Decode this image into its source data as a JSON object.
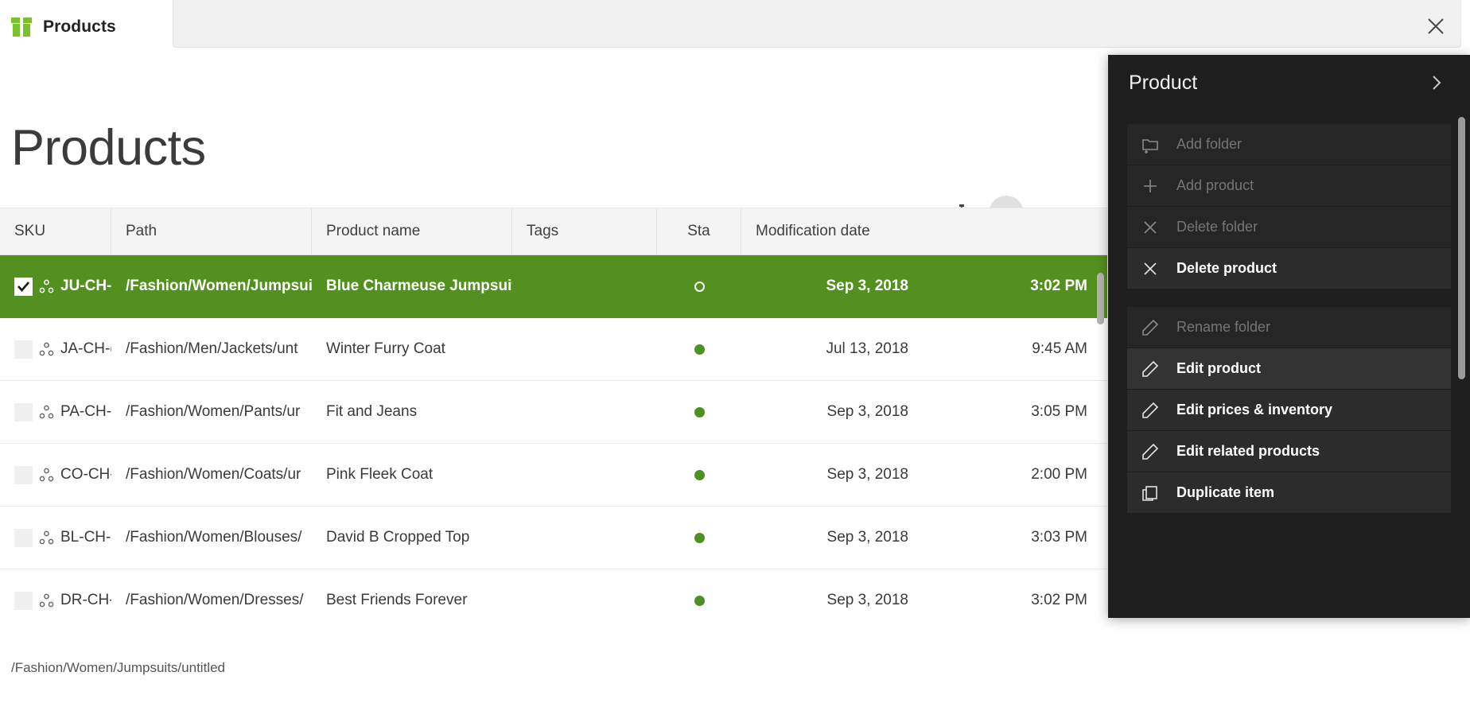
{
  "app": {
    "brand_label": "Products",
    "close_label": "×"
  },
  "page": {
    "title": "Products",
    "status_path": "/Fashion/Women/Jumpsuits/untitled"
  },
  "toolbar": {
    "tree_icon": "tree-view-icon",
    "menu_icon": "hamburger-menu-icon"
  },
  "table": {
    "columns": [
      {
        "key": "sku",
        "label": "SKU"
      },
      {
        "key": "path",
        "label": "Path"
      },
      {
        "key": "name",
        "label": "Product name"
      },
      {
        "key": "tags",
        "label": "Tags"
      },
      {
        "key": "status",
        "label": "Sta"
      },
      {
        "key": "date",
        "label": "Modification date"
      },
      {
        "key": "time",
        "label": ""
      }
    ],
    "rows": [
      {
        "sku": "JU-CH-(",
        "path": "/Fashion/Women/Jumpsui",
        "name": "Blue Charmeuse Jumpsuit",
        "tags": "",
        "status": "hollow",
        "date": "Sep 3, 2018",
        "time": "3:02 PM",
        "selected": true,
        "checked": true
      },
      {
        "sku": "JA-CH-(",
        "path": "/Fashion/Men/Jackets/unt",
        "name": "Winter Furry Coat",
        "tags": "",
        "status": "filled",
        "date": "Jul 13, 2018",
        "time": "9:45 AM",
        "selected": false,
        "checked": false
      },
      {
        "sku": "PA-CH-(",
        "path": "/Fashion/Women/Pants/ur",
        "name": "Fit and Jeans",
        "tags": "",
        "status": "filled",
        "date": "Sep 3, 2018",
        "time": "3:05 PM",
        "selected": false,
        "checked": false
      },
      {
        "sku": "CO-CH-(",
        "path": "/Fashion/Women/Coats/ur",
        "name": "Pink Fleek Coat",
        "tags": "",
        "status": "filled",
        "date": "Sep 3, 2018",
        "time": "2:00 PM",
        "selected": false,
        "checked": false
      },
      {
        "sku": "BL-CH-(",
        "path": "/Fashion/Women/Blouses/",
        "name": "David B Cropped Top",
        "tags": "",
        "status": "filled",
        "date": "Sep 3, 2018",
        "time": "3:03 PM",
        "selected": false,
        "checked": false
      },
      {
        "sku": "DR-CH-(",
        "path": "/Fashion/Women/Dresses/",
        "name": "Best Friends Forever",
        "tags": "",
        "status": "filled",
        "date": "Sep 3, 2018",
        "time": "3:02 PM",
        "selected": false,
        "checked": false
      }
    ]
  },
  "context_panel": {
    "title": "Product",
    "groups": [
      {
        "items": [
          {
            "label": "Add folder",
            "icon": "add-folder-icon",
            "state": "disabled"
          },
          {
            "label": "Add product",
            "icon": "plus-icon",
            "state": "disabled"
          },
          {
            "label": "Delete folder",
            "icon": "close-x-icon",
            "state": "disabled"
          },
          {
            "label": "Delete product",
            "icon": "close-x-icon",
            "state": "enabled"
          }
        ]
      },
      {
        "items": [
          {
            "label": "Rename folder",
            "icon": "pencil-icon",
            "state": "disabled"
          },
          {
            "label": "Edit product",
            "icon": "pencil-icon",
            "state": "hover"
          },
          {
            "label": "Edit prices & inventory",
            "icon": "pencil-icon",
            "state": "enabled"
          },
          {
            "label": "Edit related products",
            "icon": "pencil-icon",
            "state": "enabled"
          },
          {
            "label": "Duplicate item",
            "icon": "duplicate-icon",
            "state": "enabled"
          }
        ]
      }
    ]
  },
  "colors": {
    "brand_green": "#7cc02e",
    "selection_green": "#54901f",
    "status_green": "#4f9022",
    "panel_dark": "#1e1e1e"
  }
}
